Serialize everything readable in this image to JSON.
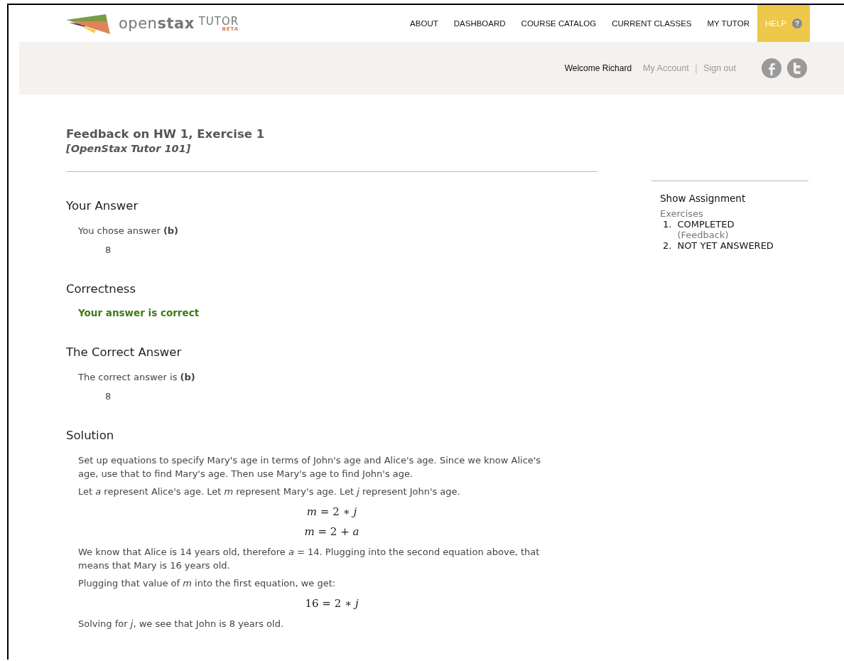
{
  "logo": {
    "brand_light": "open",
    "brand_bold": "stax",
    "product": "TUTOR",
    "badge": "BETA"
  },
  "nav": [
    {
      "label": "ABOUT",
      "selected": false
    },
    {
      "label": "DASHBOARD",
      "selected": false
    },
    {
      "label": "COURSE CATALOG",
      "selected": false
    },
    {
      "label": "CURRENT CLASSES",
      "selected": false
    },
    {
      "label": "MY TUTOR",
      "selected": false
    },
    {
      "label": "HELP",
      "selected": true,
      "help_icon": "?"
    }
  ],
  "user_bar": {
    "welcome": "Welcome Richard",
    "links": [
      "My Account",
      "Sign out"
    ],
    "separator": "|"
  },
  "page": {
    "title": "Feedback on HW 1, Exercise 1",
    "subtitle": "[OpenStax Tutor 101]"
  },
  "sections": [
    {
      "heading": "Your Answer",
      "kind": "answer",
      "text": "You chose answer **(b)**",
      "value": "8"
    },
    {
      "heading": "Correctness",
      "kind": "verdict",
      "text": "Your answer is correct"
    },
    {
      "heading": "The Correct Answer",
      "kind": "answer",
      "text": "The correct answer is **(b)**",
      "value": "8"
    },
    {
      "heading": "Solution",
      "kind": "solution",
      "blocks": [
        {
          "kind": "text",
          "text": "Set up equations to specify Mary's age in terms of John's age and Alice's age. Since we know Alice's age, use that to find Mary's age. Then use Mary's age to find John's age."
        },
        {
          "kind": "text",
          "text": "Let *a* represent Alice's age. Let *m* represent Mary's age. Let *j* represent John's age."
        },
        {
          "kind": "equation",
          "text": "*m* = 2 ∗ *j*"
        },
        {
          "kind": "equation",
          "text": "*m* = 2 + *a*"
        },
        {
          "kind": "text",
          "text": "We know that Alice is 14 years old, therefore *a* = 14. Plugging into the second equation above, that means that Mary is 16 years old."
        },
        {
          "kind": "text",
          "text": "Plugging that value of *m* into the first equation, we get:"
        },
        {
          "kind": "equation",
          "text": "16 = 2 ∗ *j*"
        },
        {
          "kind": "text",
          "text": "Solving for *j*, we see that John is 8 years old."
        }
      ]
    }
  ],
  "sidebar": {
    "title": "Show Assignment",
    "subtitle": "Exercises",
    "items": [
      {
        "number": "1.",
        "status": "COMPLETED",
        "note": "(Feedback)"
      },
      {
        "number": "2.",
        "status": "NOT YET ANSWERED"
      }
    ]
  }
}
